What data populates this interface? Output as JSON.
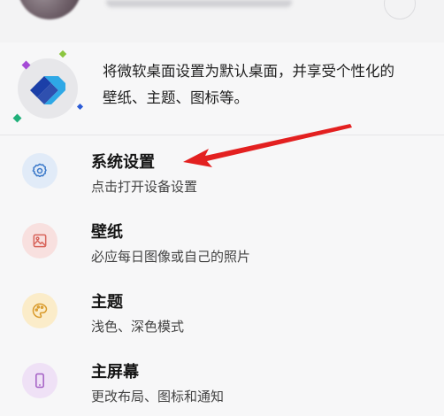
{
  "promo": {
    "line1": "将微软桌面设置为默认桌面，并享受个性化的",
    "line2": "壁纸、主题、图标等。"
  },
  "settings": {
    "items": [
      {
        "title": "系统设置",
        "subtitle": "点击打开设备设置",
        "icon": "gear-icon",
        "icon_bg": "#e1ebf8",
        "icon_color": "#3a78c9"
      },
      {
        "title": "壁纸",
        "subtitle": "必应每日图像或自己的照片",
        "icon": "image-icon",
        "icon_bg": "#f8e0df",
        "icon_color": "#d8655c"
      },
      {
        "title": "主题",
        "subtitle": "浅色、深色模式",
        "icon": "palette-icon",
        "icon_bg": "#fbecc9",
        "icon_color": "#d99a2b"
      },
      {
        "title": "主屏幕",
        "subtitle": "更改布局、图标和通知",
        "icon": "phone-icon",
        "icon_bg": "#efe1f6",
        "icon_color": "#a35ec4"
      }
    ]
  },
  "colors": {
    "annotation_arrow": "#e32020",
    "logo_dark": "#1b3fa8",
    "logo_light": "#2ea8e6"
  }
}
